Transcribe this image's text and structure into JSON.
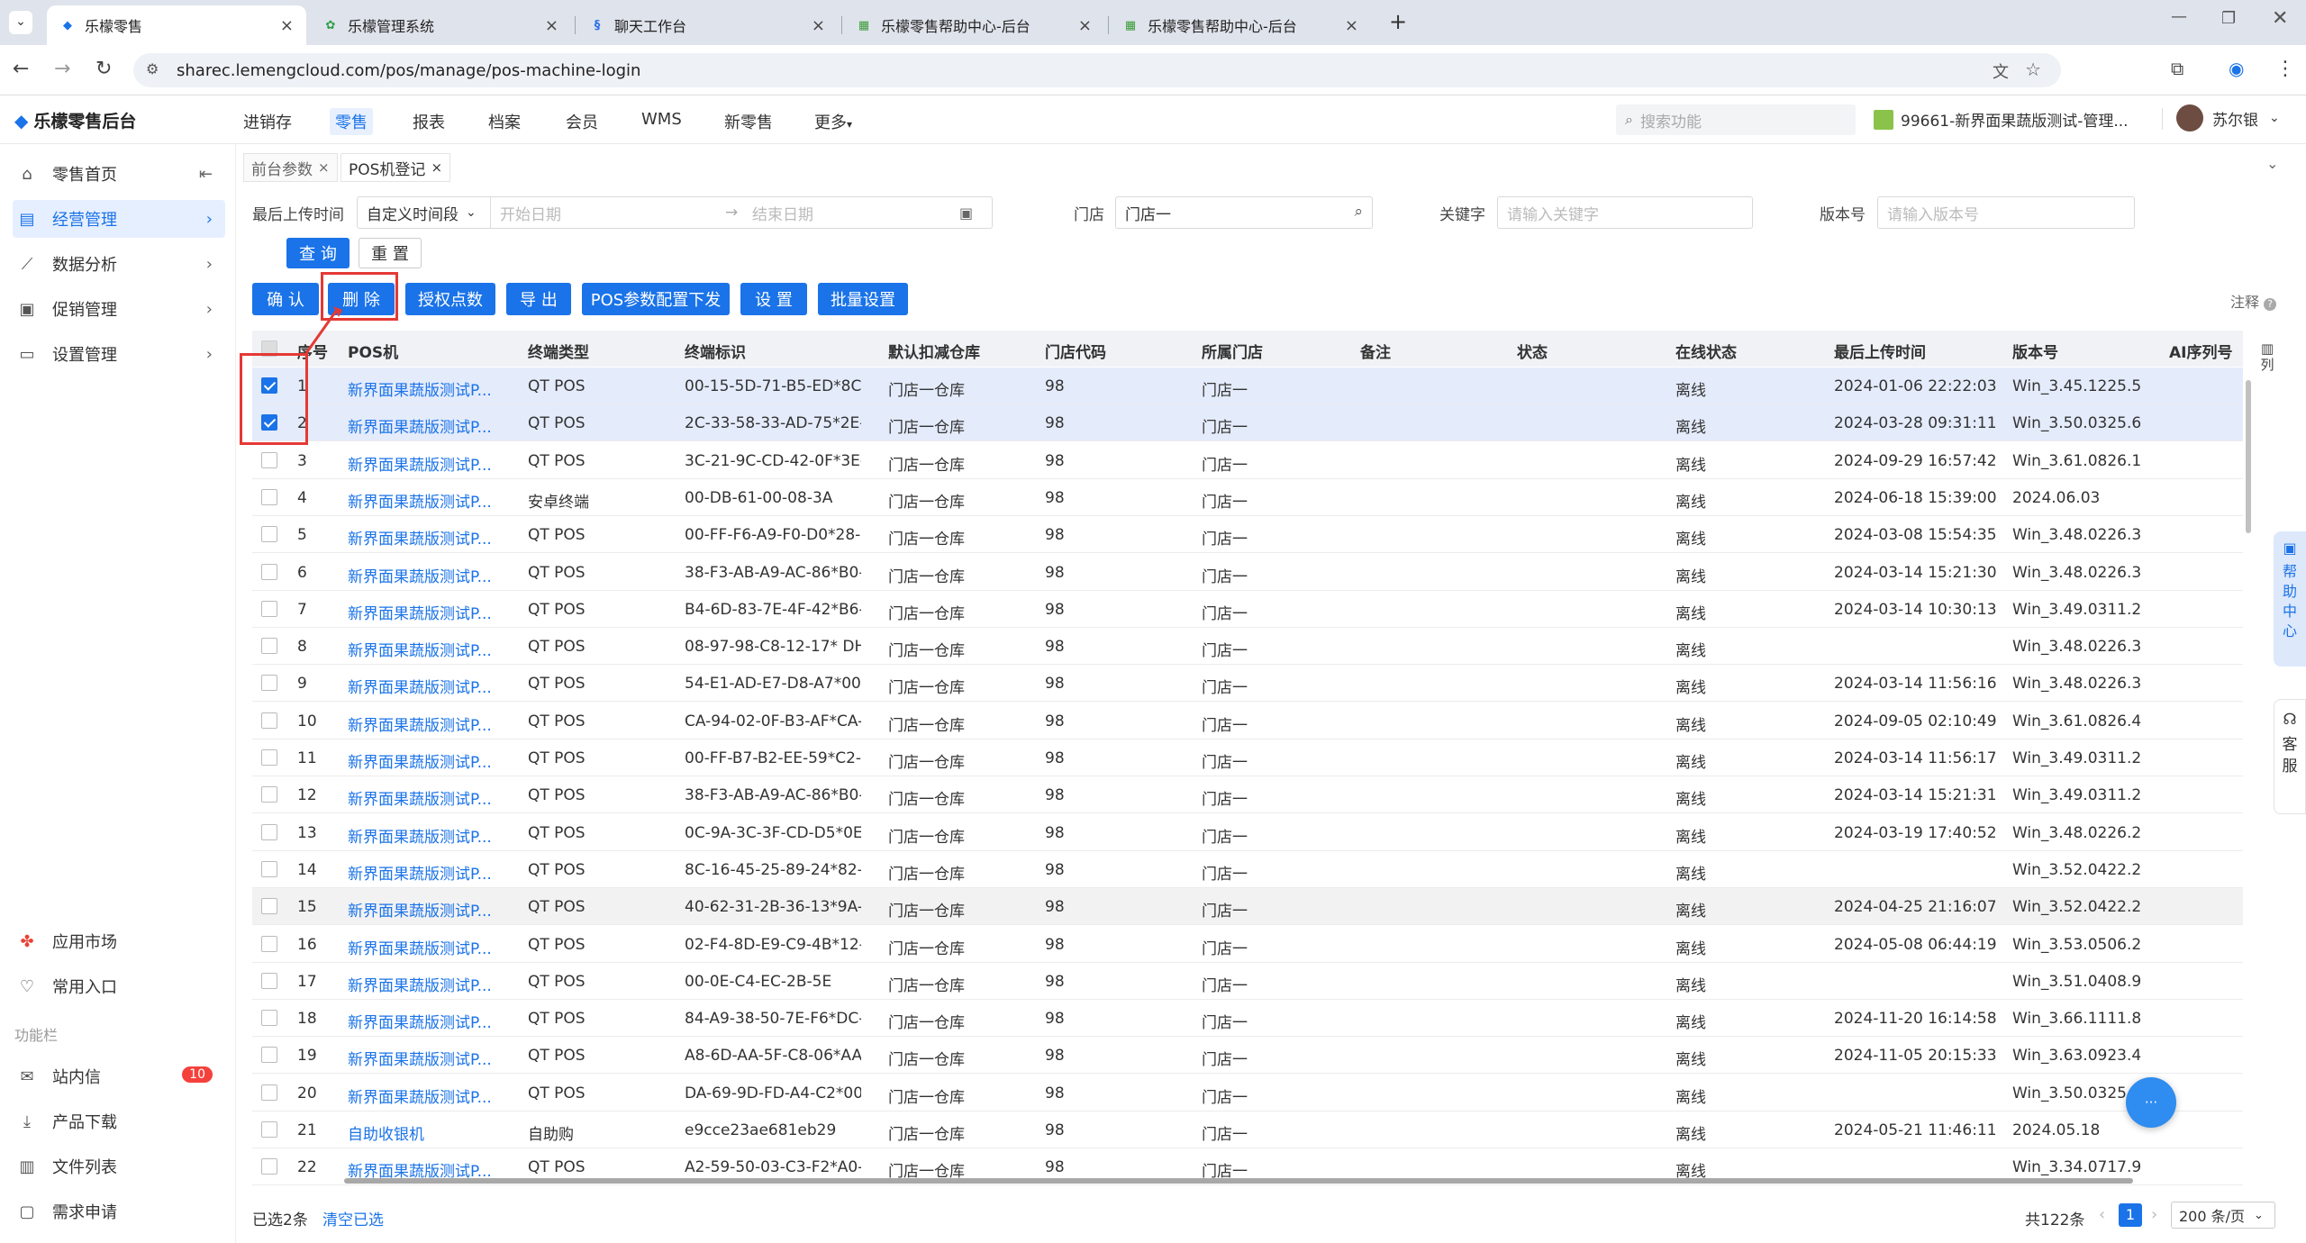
{
  "browser": {
    "tabs": [
      {
        "title": "乐檬零售",
        "active": true
      },
      {
        "title": "乐檬管理系统",
        "active": false
      },
      {
        "title": "聊天工作台",
        "active": false
      },
      {
        "title": "乐檬零售帮助中心-后台",
        "active": false
      },
      {
        "title": "乐檬零售帮助中心-后台",
        "active": false
      }
    ],
    "url": "sharec.lemengcloud.com/pos/manage/pos-machine-login"
  },
  "header": {
    "logo": "乐檬零售后台",
    "nav": [
      "进销存",
      "零售",
      "报表",
      "档案",
      "会员",
      "WMS",
      "新零售",
      "更多"
    ],
    "active_nav": "零售",
    "search_placeholder": "搜索功能",
    "store": "99661-新界面果蔬版测试-管理...",
    "user": "苏尔银"
  },
  "sidebar": {
    "items": [
      {
        "label": "零售首页",
        "icon": "home-icon"
      },
      {
        "label": "经营管理",
        "icon": "chart-board-icon"
      },
      {
        "label": "数据分析",
        "icon": "line-chart-icon"
      },
      {
        "label": "促销管理",
        "icon": "promotion-icon"
      },
      {
        "label": "设置管理",
        "icon": "settings-icon"
      }
    ],
    "bottom": [
      {
        "label": "应用市场",
        "icon": "app-market-icon"
      },
      {
        "label": "常用入口",
        "icon": "heart-icon"
      }
    ],
    "section_title": "功能栏",
    "tools": [
      {
        "label": "站内信",
        "icon": "message-icon",
        "badge": "10"
      },
      {
        "label": "产品下载",
        "icon": "download-icon"
      },
      {
        "label": "文件列表",
        "icon": "file-list-icon"
      },
      {
        "label": "需求申请",
        "icon": "request-icon"
      }
    ]
  },
  "page_tabs": [
    "前台参数",
    "POS机登记"
  ],
  "filters": {
    "upload_time_label": "最后上传时间",
    "time_mode": "自定义时间段",
    "start_placeholder": "开始日期",
    "end_placeholder": "结束日期",
    "store_label": "门店",
    "store_value": "门店一",
    "keyword_label": "关键字",
    "keyword_placeholder": "请输入关键字",
    "version_label": "版本号",
    "version_placeholder": "请输入版本号",
    "query_button": "查 询",
    "reset_button": "重 置"
  },
  "toolbar": {
    "buttons": [
      "确 认",
      "删 除",
      "授权点数",
      "导 出",
      "POS参数配置下发",
      "设 置",
      "批量设置"
    ],
    "note": "注释",
    "columns_label": "列"
  },
  "table": {
    "columns": [
      "序号",
      "POS机",
      "终端类型",
      "终端标识",
      "默认扣减仓库",
      "门店代码",
      "所属门店",
      "备注",
      "状态",
      "在线状态",
      "最后上传时间",
      "版本号",
      "AI序列号"
    ],
    "rows": [
      {
        "no": "1",
        "pos": "新界面果蔬版测试P...",
        "type": "QT POS",
        "tid": "00-15-5D-71-B5-ED*8C-...",
        "wh": "门店一仓库",
        "code": "98",
        "store": "门店一",
        "online": "离线",
        "time": "2024-01-06 22:22:03",
        "ver": "Win_3.45.1225.5",
        "checked": true
      },
      {
        "no": "2",
        "pos": "新界面果蔬版测试P...",
        "type": "QT POS",
        "tid": "2C-33-58-33-AD-75*2E-...",
        "wh": "门店一仓库",
        "code": "98",
        "store": "门店一",
        "online": "离线",
        "time": "2024-03-28 09:31:11",
        "ver": "Win_3.50.0325.6",
        "checked": true
      },
      {
        "no": "3",
        "pos": "新界面果蔬版测试P...",
        "type": "QT POS",
        "tid": "3C-21-9C-CD-42-0F*3E-...",
        "wh": "门店一仓库",
        "code": "98",
        "store": "门店一",
        "online": "离线",
        "time": "2024-09-29 16:57:42",
        "ver": "Win_3.61.0826.1",
        "checked": false
      },
      {
        "no": "4",
        "pos": "新界面果蔬版测试P...",
        "type": "安卓终端",
        "tid": "00-DB-61-00-08-3A",
        "wh": "门店一仓库",
        "code": "98",
        "store": "门店一",
        "online": "离线",
        "time": "2024-06-18 15:39:00",
        "ver": "2024.06.03",
        "checked": false
      },
      {
        "no": "5",
        "pos": "新界面果蔬版测试P...",
        "type": "QT POS",
        "tid": "00-FF-F6-A9-F0-D0*28-...",
        "wh": "门店一仓库",
        "code": "98",
        "store": "门店一",
        "online": "离线",
        "time": "2024-03-08 15:54:35",
        "ver": "Win_3.48.0226.3",
        "checked": false
      },
      {
        "no": "6",
        "pos": "新界面果蔬版测试P...",
        "type": "QT POS",
        "tid": "38-F3-AB-A9-AC-86*B0-...",
        "wh": "门店一仓库",
        "code": "98",
        "store": "门店一",
        "online": "离线",
        "time": "2024-03-14 15:21:30",
        "ver": "Win_3.48.0226.3",
        "checked": false
      },
      {
        "no": "7",
        "pos": "新界面果蔬版测试P...",
        "type": "QT POS",
        "tid": "B4-6D-83-7E-4F-42*B6-...",
        "wh": "门店一仓库",
        "code": "98",
        "store": "门店一",
        "online": "离线",
        "time": "2024-03-14 10:30:13",
        "ver": "Win_3.49.0311.2",
        "checked": false
      },
      {
        "no": "8",
        "pos": "新界面果蔬版测试P...",
        "type": "QT POS",
        "tid": "08-97-98-C8-12-17* DH-...",
        "wh": "门店一仓库",
        "code": "98",
        "store": "门店一",
        "online": "离线",
        "time": "",
        "ver": "Win_3.48.0226.3",
        "checked": false
      },
      {
        "no": "9",
        "pos": "新界面果蔬版测试P...",
        "type": "QT POS",
        "tid": "54-E1-AD-E7-D8-A7*00-...",
        "wh": "门店一仓库",
        "code": "98",
        "store": "门店一",
        "online": "离线",
        "time": "2024-03-14 11:56:16",
        "ver": "Win_3.48.0226.3",
        "checked": false
      },
      {
        "no": "10",
        "pos": "新界面果蔬版测试P...",
        "type": "QT POS",
        "tid": "CA-94-02-0F-B3-AF*CA-...",
        "wh": "门店一仓库",
        "code": "98",
        "store": "门店一",
        "online": "离线",
        "time": "2024-09-05 02:10:49",
        "ver": "Win_3.61.0826.4",
        "checked": false
      },
      {
        "no": "11",
        "pos": "新界面果蔬版测试P...",
        "type": "QT POS",
        "tid": "00-FF-B7-B2-EE-59*C2-...",
        "wh": "门店一仓库",
        "code": "98",
        "store": "门店一",
        "online": "离线",
        "time": "2024-03-14 11:56:17",
        "ver": "Win_3.49.0311.2",
        "checked": false
      },
      {
        "no": "12",
        "pos": "新界面果蔬版测试P...",
        "type": "QT POS",
        "tid": "38-F3-AB-A9-AC-86*B0-...",
        "wh": "门店一仓库",
        "code": "98",
        "store": "门店一",
        "online": "离线",
        "time": "2024-03-14 15:21:31",
        "ver": "Win_3.49.0311.2",
        "checked": false
      },
      {
        "no": "13",
        "pos": "新界面果蔬版测试P...",
        "type": "QT POS",
        "tid": "0C-9A-3C-3F-CD-D5*0E-...",
        "wh": "门店一仓库",
        "code": "98",
        "store": "门店一",
        "online": "离线",
        "time": "2024-03-19 17:40:52",
        "ver": "Win_3.48.0226.2",
        "checked": false
      },
      {
        "no": "14",
        "pos": "新界面果蔬版测试P...",
        "type": "QT POS",
        "tid": "8C-16-45-25-89-24*82-...",
        "wh": "门店一仓库",
        "code": "98",
        "store": "门店一",
        "online": "离线",
        "time": "",
        "ver": "Win_3.52.0422.2",
        "checked": false
      },
      {
        "no": "15",
        "pos": "新界面果蔬版测试P...",
        "type": "QT POS",
        "tid": "40-62-31-2B-36-13*9A-...",
        "wh": "门店一仓库",
        "code": "98",
        "store": "门店一",
        "online": "离线",
        "time": "2024-04-25 21:16:07",
        "ver": "Win_3.52.0422.2",
        "checked": false
      },
      {
        "no": "16",
        "pos": "新界面果蔬版测试P...",
        "type": "QT POS",
        "tid": "02-F4-8D-E9-C9-4B*12-...",
        "wh": "门店一仓库",
        "code": "98",
        "store": "门店一",
        "online": "离线",
        "time": "2024-05-08 06:44:19",
        "ver": "Win_3.53.0506.2",
        "checked": false
      },
      {
        "no": "17",
        "pos": "新界面果蔬版测试P...",
        "type": "QT POS",
        "tid": "00-0E-C4-EC-2B-5E",
        "wh": "门店一仓库",
        "code": "98",
        "store": "门店一",
        "online": "离线",
        "time": "",
        "ver": "Win_3.51.0408.9",
        "checked": false
      },
      {
        "no": "18",
        "pos": "新界面果蔬版测试P...",
        "type": "QT POS",
        "tid": "84-A9-38-50-7E-F6*DC-...",
        "wh": "门店一仓库",
        "code": "98",
        "store": "门店一",
        "online": "离线",
        "time": "2024-11-20 16:14:58",
        "ver": "Win_3.66.1111.8",
        "checked": false
      },
      {
        "no": "19",
        "pos": "新界面果蔬版测试P...",
        "type": "QT POS",
        "tid": "A8-6D-AA-5F-C8-06*AA-...",
        "wh": "门店一仓库",
        "code": "98",
        "store": "门店一",
        "online": "离线",
        "time": "2024-11-05 20:15:33",
        "ver": "Win_3.63.0923.4",
        "checked": false
      },
      {
        "no": "20",
        "pos": "新界面果蔬版测试P...",
        "type": "QT POS",
        "tid": "DA-69-9D-FD-A4-C2*00-...",
        "wh": "门店一仓库",
        "code": "98",
        "store": "门店一",
        "online": "离线",
        "time": "",
        "ver": "Win_3.50.0325.6",
        "checked": false
      },
      {
        "no": "21",
        "pos": "自助收银机",
        "type": "自助购",
        "tid": "e9cce23ae681eb29",
        "wh": "门店一仓库",
        "code": "98",
        "store": "门店一",
        "online": "离线",
        "time": "2024-05-21 11:46:11",
        "ver": "2024.05.18",
        "checked": false
      },
      {
        "no": "22",
        "pos": "新界面果蔬版测试P...",
        "type": "QT POS",
        "tid": "A2-59-50-03-C3-F2*A0-...",
        "wh": "门店一仓库",
        "code": "98",
        "store": "门店一",
        "online": "离线",
        "time": "",
        "ver": "Win_3.34.0717.9",
        "checked": false
      }
    ]
  },
  "footer": {
    "selected": "已选2条",
    "clear": "清空已选",
    "total": "共122条",
    "page": "1",
    "page_size": "200 条/页"
  },
  "side_float": {
    "help": "帮助中心",
    "service": "客服"
  },
  "colors": {
    "accent": "#1a73e8",
    "highlight": "#e53935",
    "selected_row": "#e4ebfb"
  }
}
